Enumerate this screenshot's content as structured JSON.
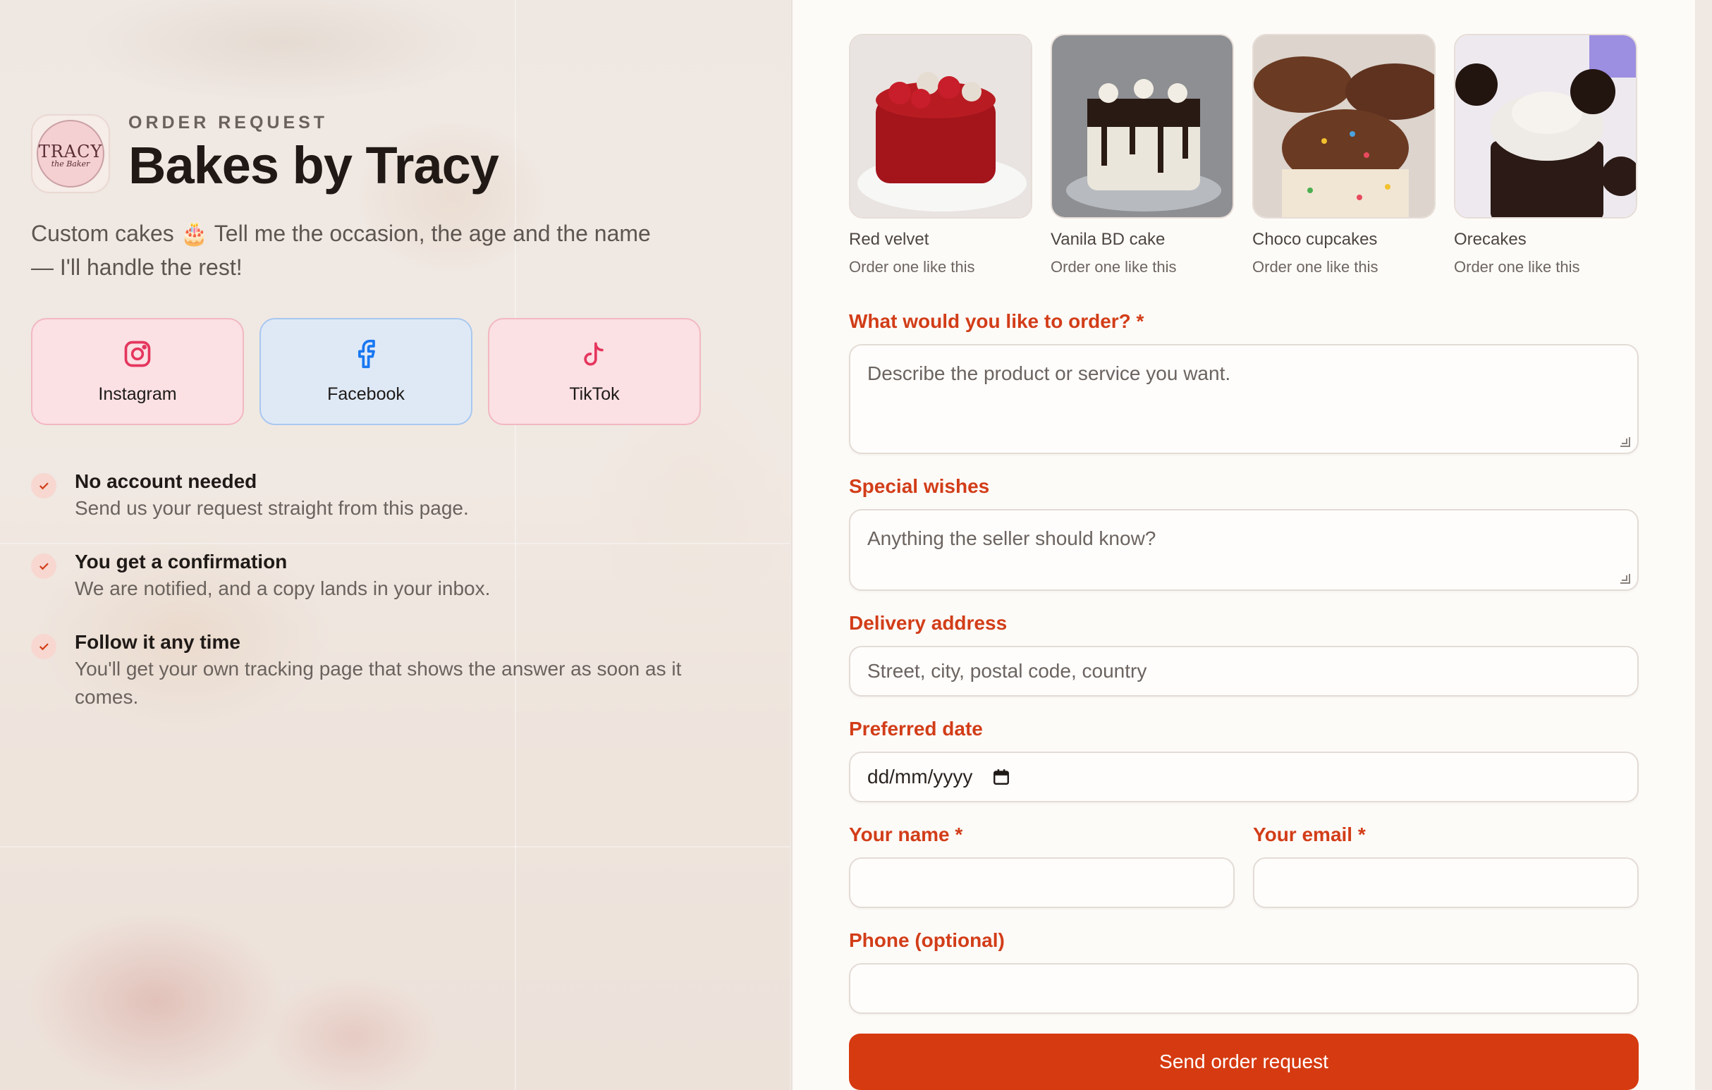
{
  "brand": {
    "eyebrow": "ORDER REQUEST",
    "name": "Bakes by Tracy",
    "logo_text": "TRACY",
    "logo_subtext": "the Baker",
    "tagline": "Custom cakes 🎂 Tell me the occasion, the age and the name — I'll handle the rest!"
  },
  "socials": [
    {
      "label": "Instagram",
      "icon": "instagram-icon",
      "color": "#e5365d"
    },
    {
      "label": "Facebook",
      "icon": "facebook-icon",
      "color": "#1877f2"
    },
    {
      "label": "TikTok",
      "icon": "tiktok-icon",
      "color": "#e5365d"
    }
  ],
  "perks": [
    {
      "title": "No account needed",
      "desc": "Send us your request straight from this page."
    },
    {
      "title": "You get a confirmation",
      "desc": "We are notified, and a copy lands in your inbox."
    },
    {
      "title": "Follow it any time",
      "desc": "You'll get your own tracking page that shows the answer as soon as it comes."
    }
  ],
  "gallery": [
    {
      "name": "Red velvet",
      "link": "Order one like this"
    },
    {
      "name": "Vanila BD cake",
      "link": "Order one like this"
    },
    {
      "name": "Choco cupcakes",
      "link": "Order one like this"
    },
    {
      "name": "Orecakes",
      "link": "Order one like this"
    }
  ],
  "form": {
    "order": {
      "label": "What would you like to order? *",
      "placeholder": "Describe the product or service you want."
    },
    "wishes": {
      "label": "Special wishes",
      "placeholder": "Anything the seller should know?"
    },
    "address": {
      "label": "Delivery address",
      "placeholder": "Street, city, postal code, country"
    },
    "date": {
      "label": "Preferred date",
      "placeholder": "dd/mm/yyyy"
    },
    "name": {
      "label": "Your name *",
      "value": ""
    },
    "email": {
      "label": "Your email *",
      "value": ""
    },
    "phone": {
      "label": "Phone (optional)",
      "value": ""
    },
    "submit_label": "Send order request"
  },
  "colors": {
    "accent": "#d63a10",
    "label": "#d23d18"
  }
}
